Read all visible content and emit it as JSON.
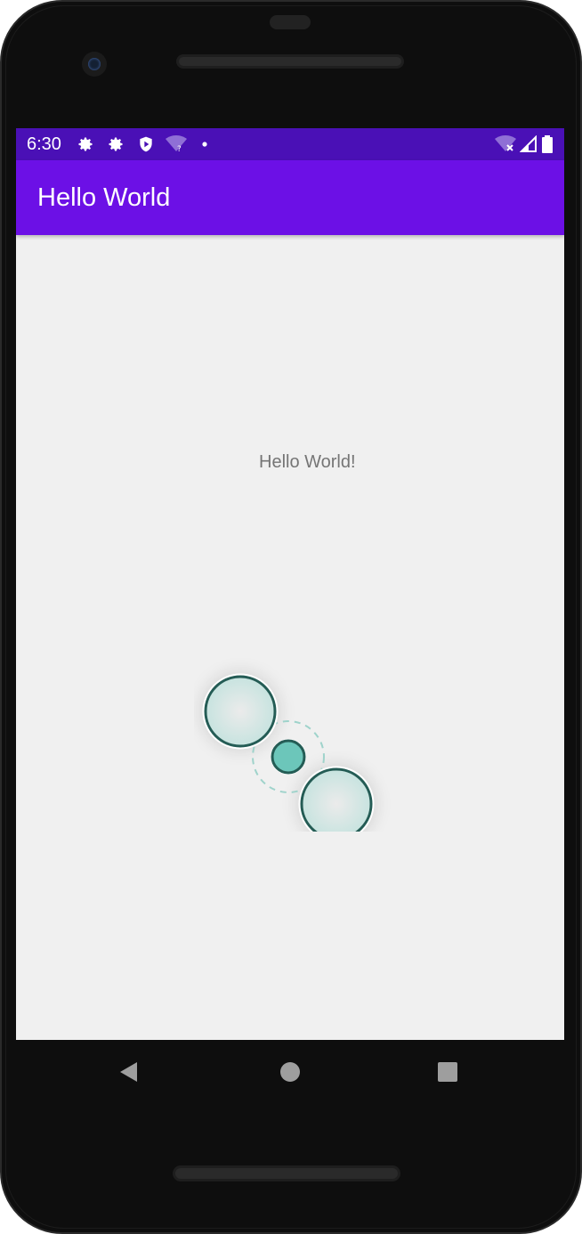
{
  "status_bar": {
    "time": "6:30",
    "left_icons": [
      "gear-icon",
      "gear-icon",
      "play-shield-icon",
      "wifi-question-icon",
      "dot-icon"
    ],
    "right_icons": [
      "wifi-off-icon",
      "signal-icon",
      "battery-icon"
    ]
  },
  "app_bar": {
    "title": "Hello World"
  },
  "content": {
    "hello_text": "Hello World!"
  },
  "gesture_indicator": {
    "type": "pinch-zoom",
    "colors": {
      "fill": "#cfe7e4",
      "stroke": "#245c55",
      "center": "#6cc6ba",
      "dashed": "#9fd3cb"
    }
  },
  "nav_bar": {
    "buttons": [
      "back-icon",
      "home-icon",
      "recents-icon"
    ]
  },
  "colors": {
    "status_bar": "#4a10b6",
    "app_bar": "#6c10e6",
    "screen_bg": "#f0f0f0",
    "hello_text": "#757575"
  }
}
